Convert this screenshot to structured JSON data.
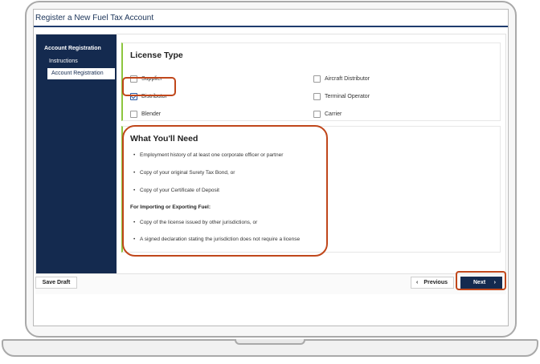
{
  "app": {
    "title": "Register a New Fuel Tax Account"
  },
  "sidebar": {
    "heading": "Account Registration",
    "items": [
      {
        "label": "Instructions",
        "active": false
      },
      {
        "label": "Account Registration",
        "active": true
      }
    ]
  },
  "license": {
    "title": "License Type",
    "options": [
      {
        "label": "Supplier",
        "checked": false
      },
      {
        "label": "Distributor",
        "checked": true
      },
      {
        "label": "Blender",
        "checked": false
      },
      {
        "label": "Aircraft Distributor",
        "checked": false
      },
      {
        "label": "Terminal Operator",
        "checked": false
      },
      {
        "label": "Carrier",
        "checked": false
      }
    ]
  },
  "need": {
    "title": "What You'll Need",
    "bullets": [
      "Employment history of at least one corporate officer or partner",
      "Copy of your original Surety Tax Bond, or",
      "Copy of your Certificate of Deposit"
    ],
    "subheading": "For Importing or Exporting Fuel:",
    "sub_bullets": [
      "Copy of the license issued by other jurisdictions, or",
      "A signed declaration stating the jurisdiction does not require a license"
    ]
  },
  "footer": {
    "save_draft": "Save Draft",
    "previous": "Previous",
    "next": "Next"
  },
  "colors": {
    "navy": "#142a4f",
    "accent_green": "#8dc63f",
    "highlight": "#c0471b",
    "check_blue": "#2b5aa3"
  }
}
